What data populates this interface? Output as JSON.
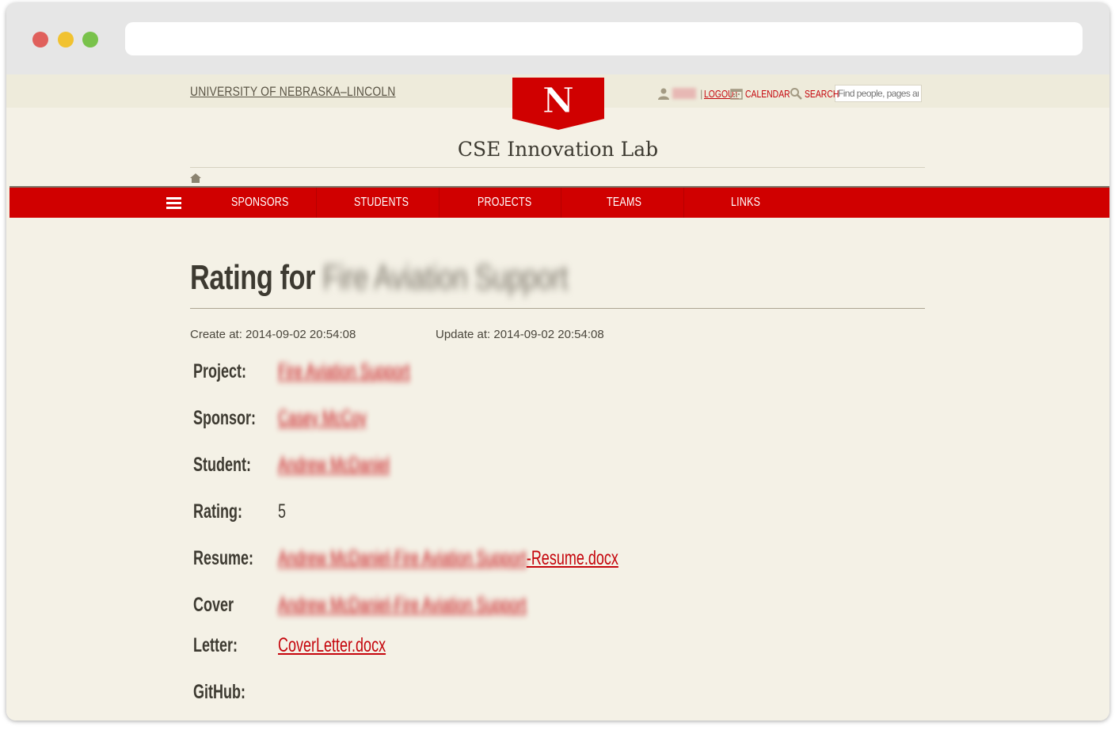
{
  "header": {
    "university": "UNIVERSITY OF NEBRASKA–LINCOLN",
    "logo_letter": "N",
    "logout": "LOGOUT",
    "calendar": "CALENDAR",
    "search_label": "SEARCH",
    "search_placeholder": "Find people, pages and things",
    "site_title": "CSE Innovation Lab"
  },
  "nav": {
    "items": [
      {
        "label": "SPONSORS"
      },
      {
        "label": "STUDENTS"
      },
      {
        "label": "PROJECTS"
      },
      {
        "label": "TEAMS"
      },
      {
        "label": "LINKS"
      }
    ]
  },
  "main": {
    "heading_prefix": "Rating for",
    "heading_subject": "Fire Aviation Support",
    "created": "Create at: 2014-09-02 20:54:08",
    "updated": "Update at: 2014-09-02 20:54:08",
    "fields": {
      "project_label": "Project:",
      "project_value": "Fire Aviation Support",
      "sponsor_label": "Sponsor:",
      "sponsor_value": "Casey McCoy",
      "student_label": "Student:",
      "student_value": "Andrew McDaniel",
      "rating_label": "Rating:",
      "rating_value": "5",
      "resume_label": "Resume:",
      "resume_blurred": "Andrew McDaniel-Fire Aviation Support",
      "resume_suffix": "-Resume.docx",
      "cover_label_1": "Cover",
      "cover_label_2": "Letter:",
      "cover_blurred": "Andrew McDaniel-Fire Aviation Support",
      "cover_file": "CoverLetter.docx",
      "github_label": "GitHub:"
    }
  },
  "colors": {
    "brand_red": "#d00000",
    "link_red": "#c5050c",
    "page_bg": "#f4f1e6"
  }
}
